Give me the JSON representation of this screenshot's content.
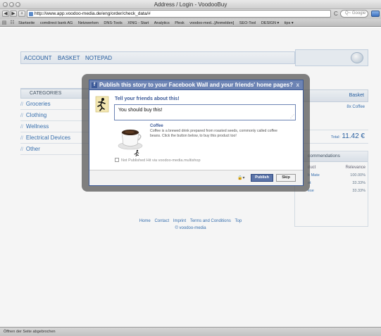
{
  "window": {
    "title": "Address / Login - VoodooBuy"
  },
  "browser": {
    "back_glyph": "◀",
    "forward_glyph": "▶",
    "add_glyph": "+",
    "url": "http://www.app.voodoo-media.de/eng/order/check_data/#",
    "reload_glyph": "C",
    "search_placeholder": "Q~ Google",
    "bookmarks_icons": [
      "book-icon",
      "grid-icon"
    ],
    "bookmarks": [
      "Startseite",
      "comdirect bank AG",
      "Netzwerken",
      "DNS-Tools",
      "XING - Start",
      "Analytics",
      "Plesk",
      "voodoo-med...[Anmelden]",
      "SEO-Tool",
      "DESIGN ▾",
      "tips ▾"
    ]
  },
  "shop": {
    "nav": [
      "ACCOUNT",
      "BASKET",
      "NOTEPAD"
    ],
    "categories_title": "CATEGORIES",
    "categories": [
      "Groceries",
      "Clothing",
      "Wellness",
      "Electrical Devices",
      "Other"
    ],
    "basket_title": "Basket",
    "basket_item": "8x Coffee",
    "total_label": "Total:",
    "total_value": "11.42 €",
    "recommendations_title": "commendations",
    "rec_col1": "duct",
    "rec_col2": "Relevance",
    "recommendations": [
      {
        "name": "b Mate",
        "value": "100.00%"
      },
      {
        "name": "ot",
        "value": "33.33%"
      },
      {
        "name": "ese",
        "value": "33.33%"
      }
    ],
    "footer_links": [
      "Home",
      "Contact",
      "Imprint",
      "Terms and Conditions",
      "Top"
    ],
    "footer_copy": "© voodoo-media"
  },
  "dialog": {
    "fb_glyph": "f",
    "title": "Publish this story to your Facebook Wall and your friends' home pages?",
    "close_glyph": "x",
    "prompt": "Tell your friends about this!",
    "message": "You should buy this!",
    "grip_glyph": "⋰",
    "product_name": "Coffee",
    "product_desc": "Coffee is a brewed drink prepared from roasted seeds, commonly called coffee beans. Click the button below, to buy this product too!",
    "optout_label": "Not Published Hit via voodoo-media.multishop",
    "lock_glyph": "🔒▾",
    "publish_label": "Publish",
    "skip_label": "Skip"
  },
  "status": {
    "text": "Öffnen der Seite abgebrochen"
  },
  "colors": {
    "facebook_blue": "#3b5998",
    "facebook_header": "#6d84b4",
    "link_blue": "#3a74b5"
  }
}
